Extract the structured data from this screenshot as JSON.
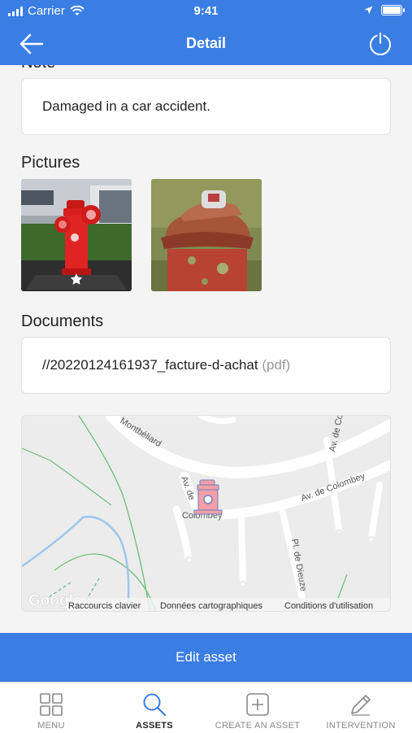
{
  "status_bar": {
    "carrier": "Carrier",
    "time": "9:41"
  },
  "navbar": {
    "title": "Detail"
  },
  "note": {
    "section_title": "Note",
    "text": "Damaged in a car accident."
  },
  "pictures": {
    "section_title": "Pictures"
  },
  "documents": {
    "section_title": "Documents",
    "name": "//20220124161937_facture-d-achat",
    "extension": "(pdf)"
  },
  "map": {
    "logo": "Google",
    "footer": [
      "Raccourcis clavier",
      "Données cartographiques",
      "Conditions d'utilisation"
    ],
    "streets": [
      "Montbéliard",
      "Av. de Colombey",
      "Av. de Colombey",
      "Pl. de Dieuze"
    ]
  },
  "edit_button": "Edit asset",
  "tabs": [
    {
      "label": "MENU",
      "icon": "grid-icon"
    },
    {
      "label": "ASSETS",
      "icon": "search-icon"
    },
    {
      "label": "CREATE AN ASSET",
      "icon": "plus-square-icon"
    },
    {
      "label": "INTERVENTION",
      "icon": "pencil-icon"
    }
  ],
  "colors": {
    "primary": "#3a7de3",
    "hydrant": "#e53935"
  }
}
